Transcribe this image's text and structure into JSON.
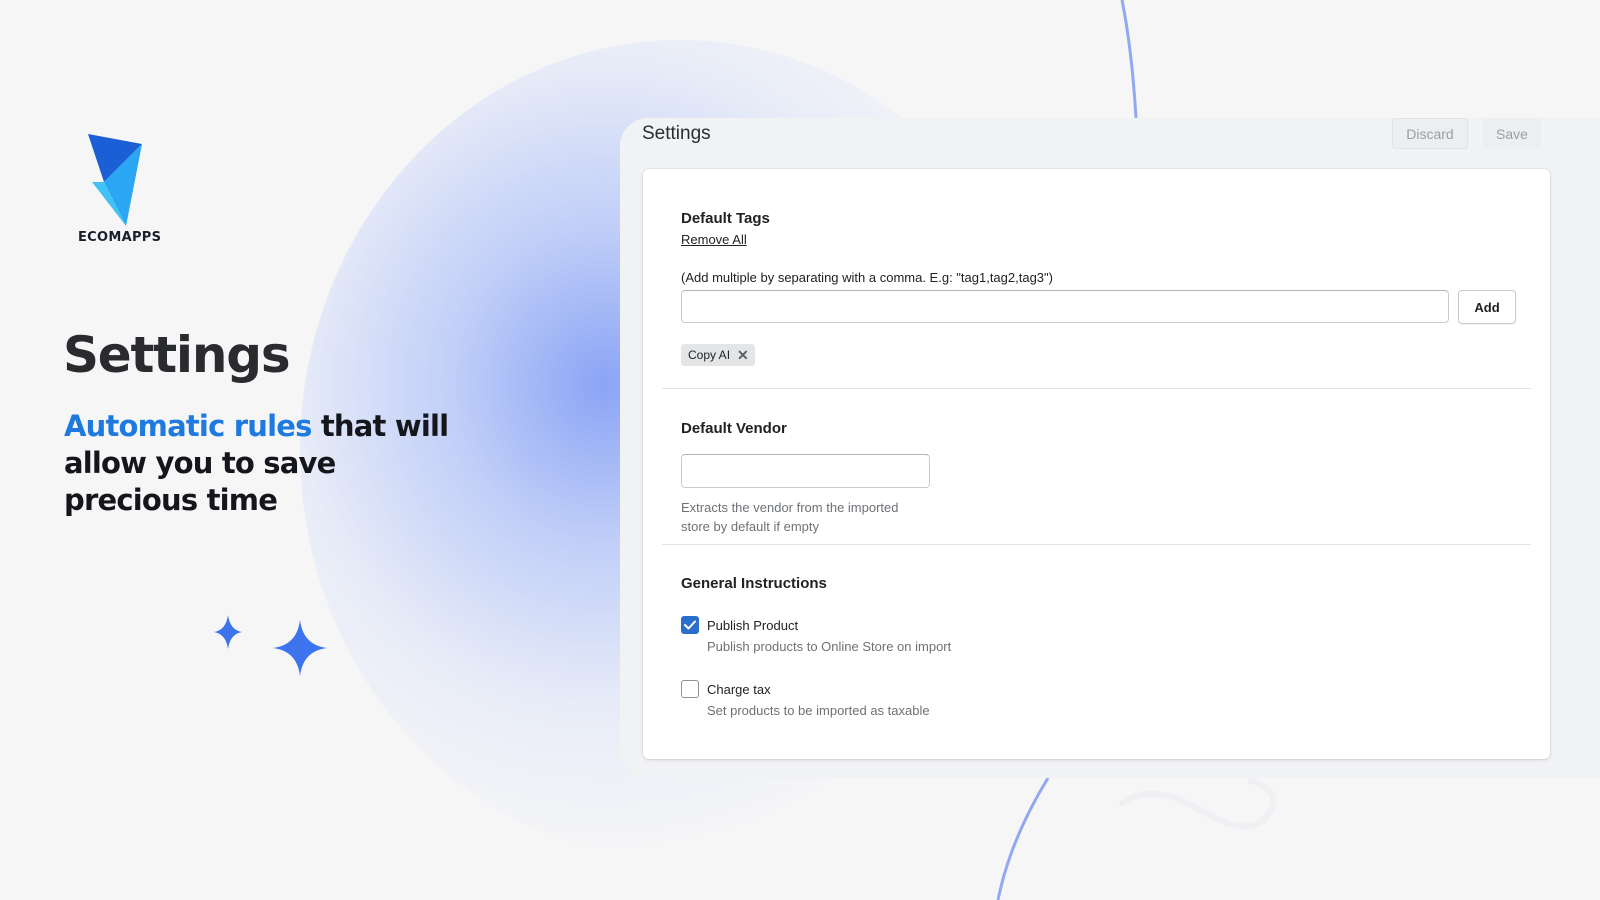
{
  "brand": {
    "name": "ECOMAPPS",
    "colors": {
      "accent": "#1f7ae0",
      "glow": "#7f9ff5",
      "primary_button": "#2c6ecb"
    }
  },
  "hero": {
    "title": "Settings",
    "subtitle_accent": "Automatic rules",
    "subtitle_rest": " that will allow you to save precious time"
  },
  "decorations": {
    "sparkles_icon": "four-point-star-icon"
  },
  "panel": {
    "title": "Settings",
    "discard_label": "Discard",
    "save_label": "Save"
  },
  "tags_section": {
    "heading": "Default Tags",
    "remove_all_label": "Remove All",
    "hint": "(Add multiple by separating with a comma. E.g: \"tag1,tag2,tag3\")",
    "input_value": "",
    "add_label": "Add",
    "tags": [
      {
        "label": "Copy AI",
        "remove_icon": "close-icon"
      }
    ]
  },
  "vendor_section": {
    "heading": "Default Vendor",
    "input_value": "",
    "help_text": "Extracts the vendor from the imported store by default if empty"
  },
  "general_section": {
    "heading": "General Instructions",
    "options": [
      {
        "label": "Publish Product",
        "help": "Publish products to Online Store on import",
        "checked": true
      },
      {
        "label": "Charge tax",
        "help": "Set products to be imported as taxable",
        "checked": false
      }
    ]
  }
}
